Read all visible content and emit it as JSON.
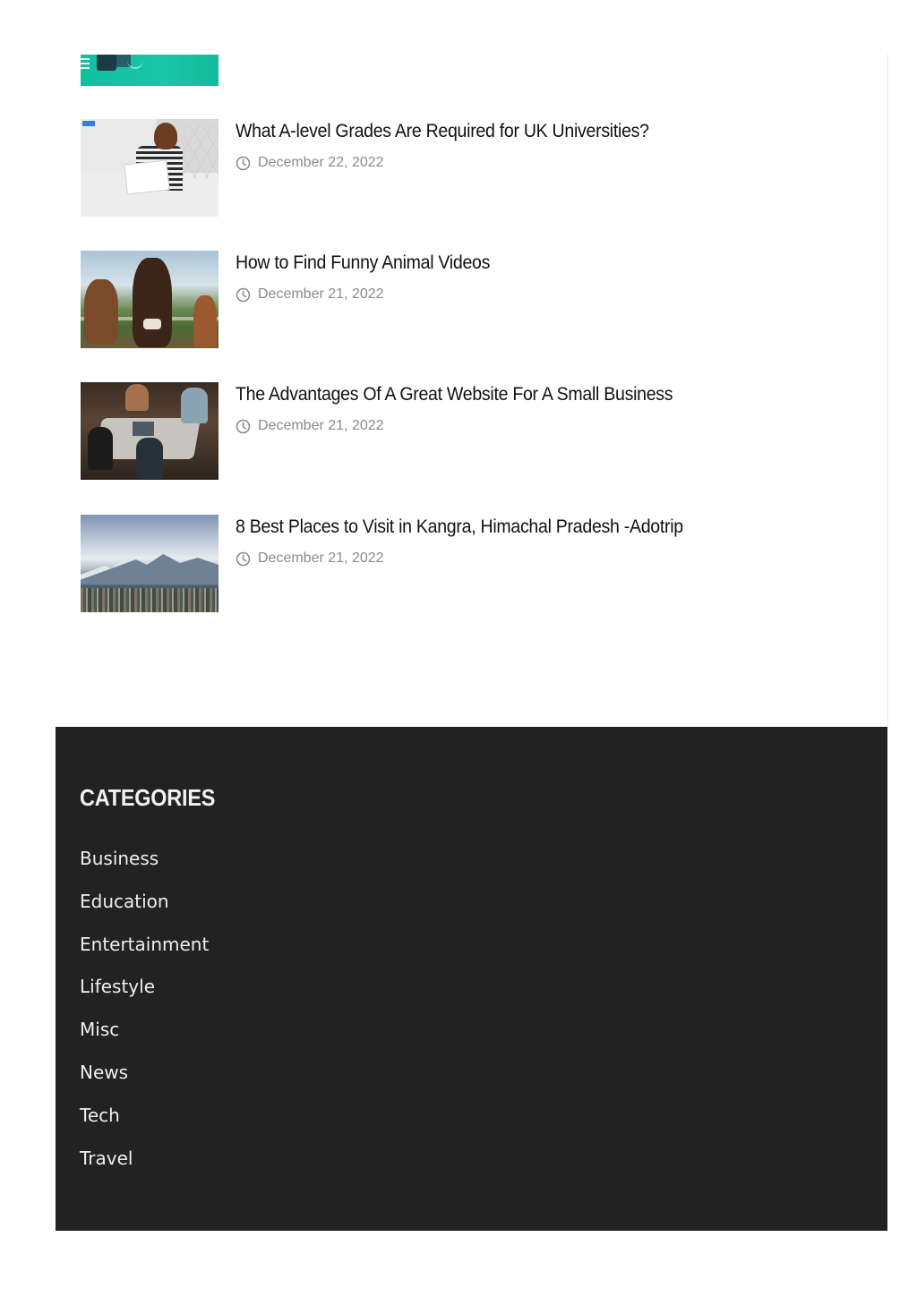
{
  "posts": [
    {
      "title": "What A-level Grades Are Required for UK Universities?",
      "date": "December 22, 2022"
    },
    {
      "title": "How to Find Funny Animal Videos",
      "date": "December 21, 2022"
    },
    {
      "title": "The Advantages Of A Great Website For A Small Business",
      "date": "December 21, 2022"
    },
    {
      "title": "8 Best Places to Visit in Kangra, Himachal Pradesh -Adotrip",
      "date": "December 21, 2022"
    }
  ],
  "footer": {
    "categories_heading": "CATEGORIES",
    "categories": [
      "Business",
      "Education",
      "Entertainment",
      "Lifestyle",
      "Misc",
      "News",
      "Tech",
      "Travel"
    ]
  },
  "colors": {
    "footer_bg": "#222222",
    "meta_text": "#8a8a8a",
    "title_text": "#111111",
    "teal_thumbnail": "#19c7a8"
  },
  "icons": {
    "date": "clock-icon"
  }
}
